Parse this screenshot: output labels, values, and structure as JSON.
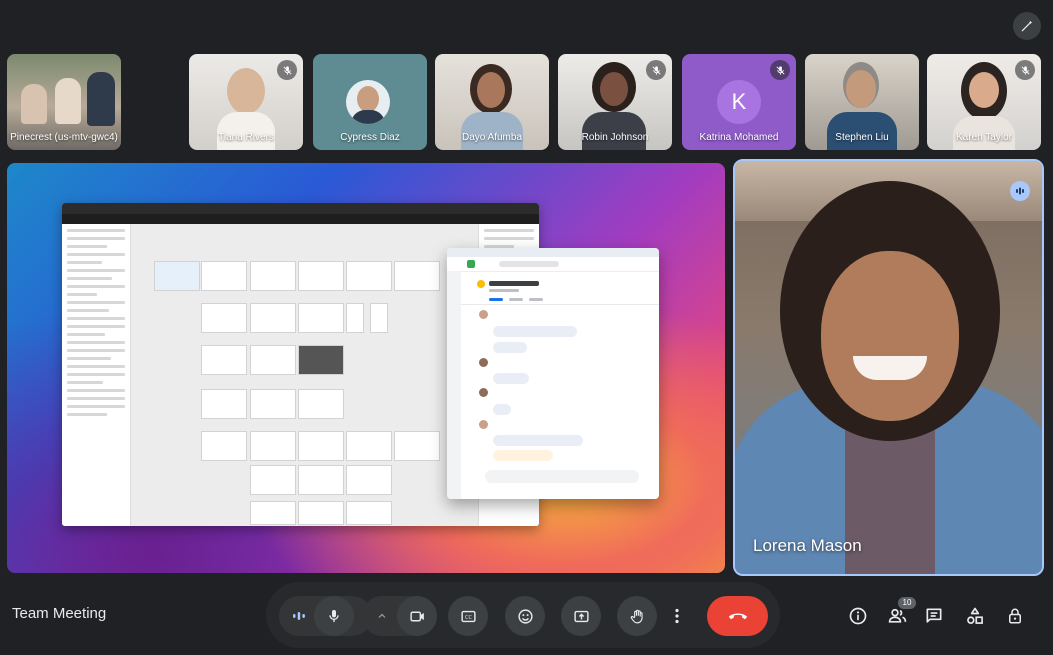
{
  "meeting": {
    "title": "Team Meeting"
  },
  "participants": [
    {
      "name": "Pinecrest (us-mtv-gwc4)",
      "muted": false,
      "bg": "#8a8f86"
    },
    {
      "name": "Tiana Rivers",
      "muted": true,
      "bg": "#d9d6d1"
    },
    {
      "name": "Cypress Diaz",
      "muted": false,
      "bg": "#5f8b93"
    },
    {
      "name": "Dayo Afumba",
      "muted": false,
      "bg": "#c9c3ba"
    },
    {
      "name": "Robin Johnson",
      "muted": true,
      "bg": "#c7c5c1"
    },
    {
      "name": "Katrina Mohamed",
      "muted": true,
      "bg": "#8e5bc9",
      "initial": "K"
    },
    {
      "name": "Stephen Liu",
      "muted": false,
      "bg": "#b9b2a6"
    },
    {
      "name": "Karen Taylor",
      "muted": true,
      "bg": "#d3d1ce"
    }
  ],
  "speaker": {
    "name": "Lorena Mason"
  },
  "controls": {
    "people_count": "10"
  },
  "colors": {
    "end_call": "#ea4335",
    "speaking_highlight": "#a8c7fa",
    "accent_purple": "#8e5bc9"
  },
  "icons": [
    "wand-icon",
    "mic-off-icon",
    "audio-level-icon",
    "mic-icon",
    "chevron-up-icon",
    "camera-icon",
    "captions-icon",
    "emoji-icon",
    "present-icon",
    "raise-hand-icon",
    "more-vert-icon",
    "end-call-icon",
    "info-icon",
    "people-icon",
    "chat-icon",
    "activities-icon",
    "lock-icon"
  ]
}
